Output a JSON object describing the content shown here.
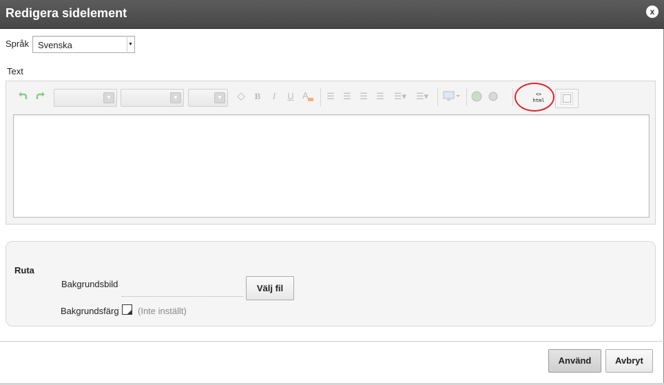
{
  "dialog": {
    "title": "Redigera sidelement",
    "close_label": "x"
  },
  "language": {
    "label": "Språk",
    "selected": "Svenska"
  },
  "text_editor": {
    "label": "Text",
    "toolbar": {
      "undo_icon": "undo-icon",
      "redo_icon": "redo-icon",
      "bold": "B",
      "italic": "I",
      "underline": "U",
      "html_button": {
        "line1": "<>",
        "line2": "html"
      }
    },
    "content": ""
  },
  "box_section": {
    "label": "Ruta",
    "background_image_label": "Bakgrundsbild",
    "choose_file_label": "Välj fil",
    "background_color_label": "Bakgrundsfärg",
    "background_color_status": "(Inte inställt)"
  },
  "footer": {
    "apply_label": "Använd",
    "cancel_label": "Avbryt"
  },
  "colors": {
    "titlebar": "#505050",
    "highlight": "#e0242a",
    "green_icons": "#8cc88a"
  }
}
